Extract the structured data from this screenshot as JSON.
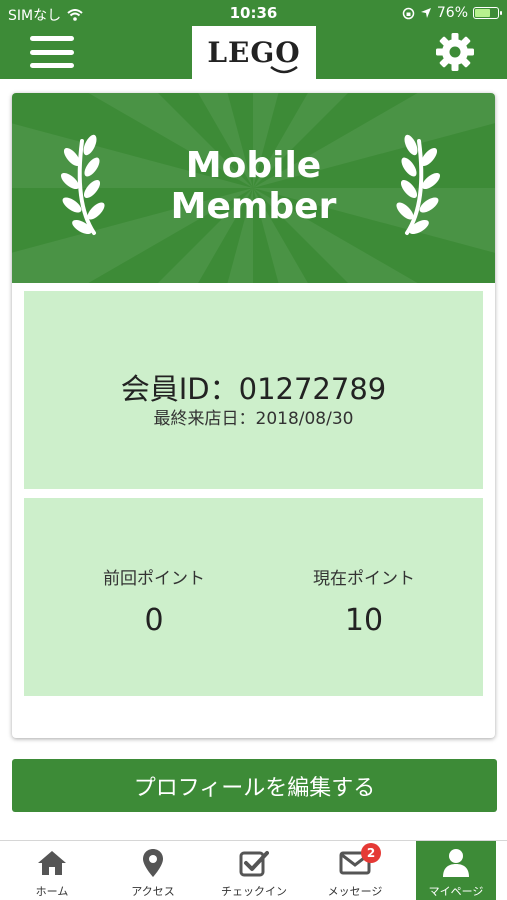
{
  "status_bar": {
    "carrier": "SIMなし",
    "time": "10:36",
    "battery": "76%",
    "battery_level": 0.76
  },
  "header": {
    "logo": "LEGO",
    "menu_icon": "hamburger-menu-icon",
    "settings_icon": "gear-icon"
  },
  "banner": {
    "title_line1": "Mobile",
    "title_line2": "Member",
    "decoration_icon": "laurel-icon"
  },
  "member": {
    "id_text": "会員ID：01272789",
    "last_visit_text": "最終来店日：2018/08/30"
  },
  "points": {
    "previous_label": "前回ポイント",
    "previous_value": "0",
    "current_label": "現在ポイント",
    "current_value": "10"
  },
  "actions": {
    "edit_profile": "プロフィールを編集する"
  },
  "tabbar": {
    "tabs": [
      {
        "label": "ホーム",
        "icon": "home-icon"
      },
      {
        "label": "アクセス",
        "icon": "map-pin-icon"
      },
      {
        "label": "チェックイン",
        "icon": "checkbox-icon"
      },
      {
        "label": "メッセージ",
        "icon": "envelope-icon",
        "badge": "2"
      },
      {
        "label": "マイページ",
        "icon": "user-icon"
      }
    ],
    "active_index": 4
  },
  "colors": {
    "brand_green": "#3d8b37",
    "panel_green": "#cdefcb",
    "badge_red": "#e53935"
  }
}
